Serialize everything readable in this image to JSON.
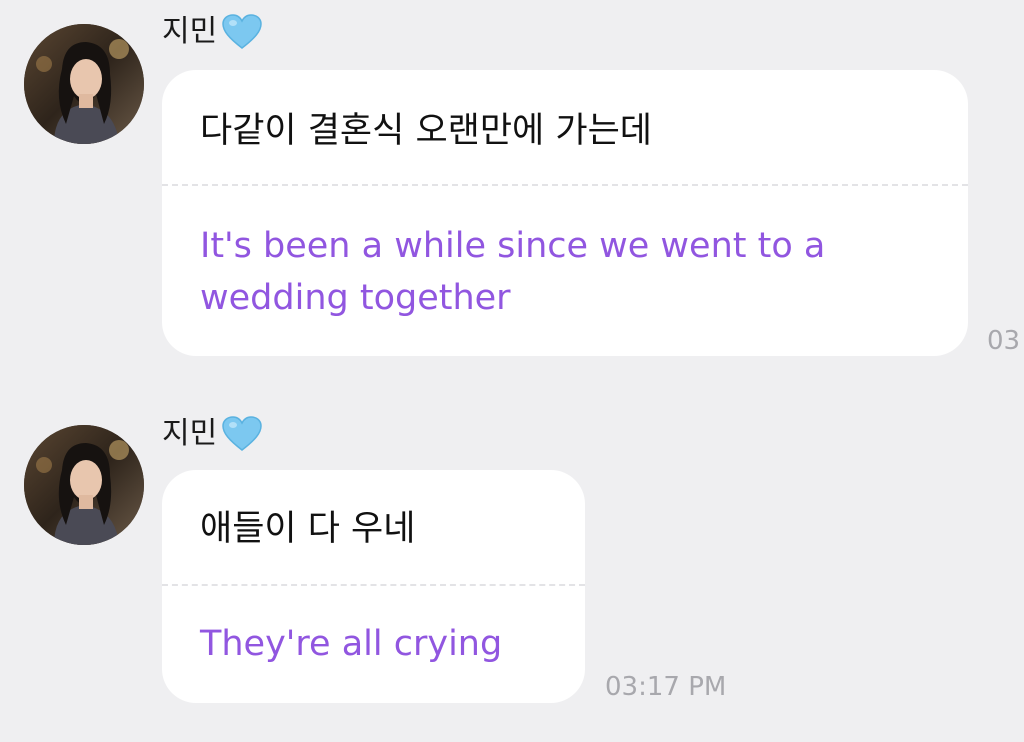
{
  "messages": [
    {
      "sender": "지민",
      "original": "다같이 결혼식 오랜만에 가는데",
      "translation": "It's been a while since we went to a wedding together",
      "time": "03"
    },
    {
      "sender": "지민",
      "original": "애들이 다 우네",
      "translation": "They're all crying",
      "time": "03:17 PM"
    }
  ],
  "colors": {
    "background": "#efeff1",
    "bubble": "#ffffff",
    "translation_text": "#9156e0",
    "timestamp": "#a8a8ad",
    "heart": "#7cc8f0"
  },
  "icons": {
    "sender_badge": "light-blue-heart-icon"
  }
}
